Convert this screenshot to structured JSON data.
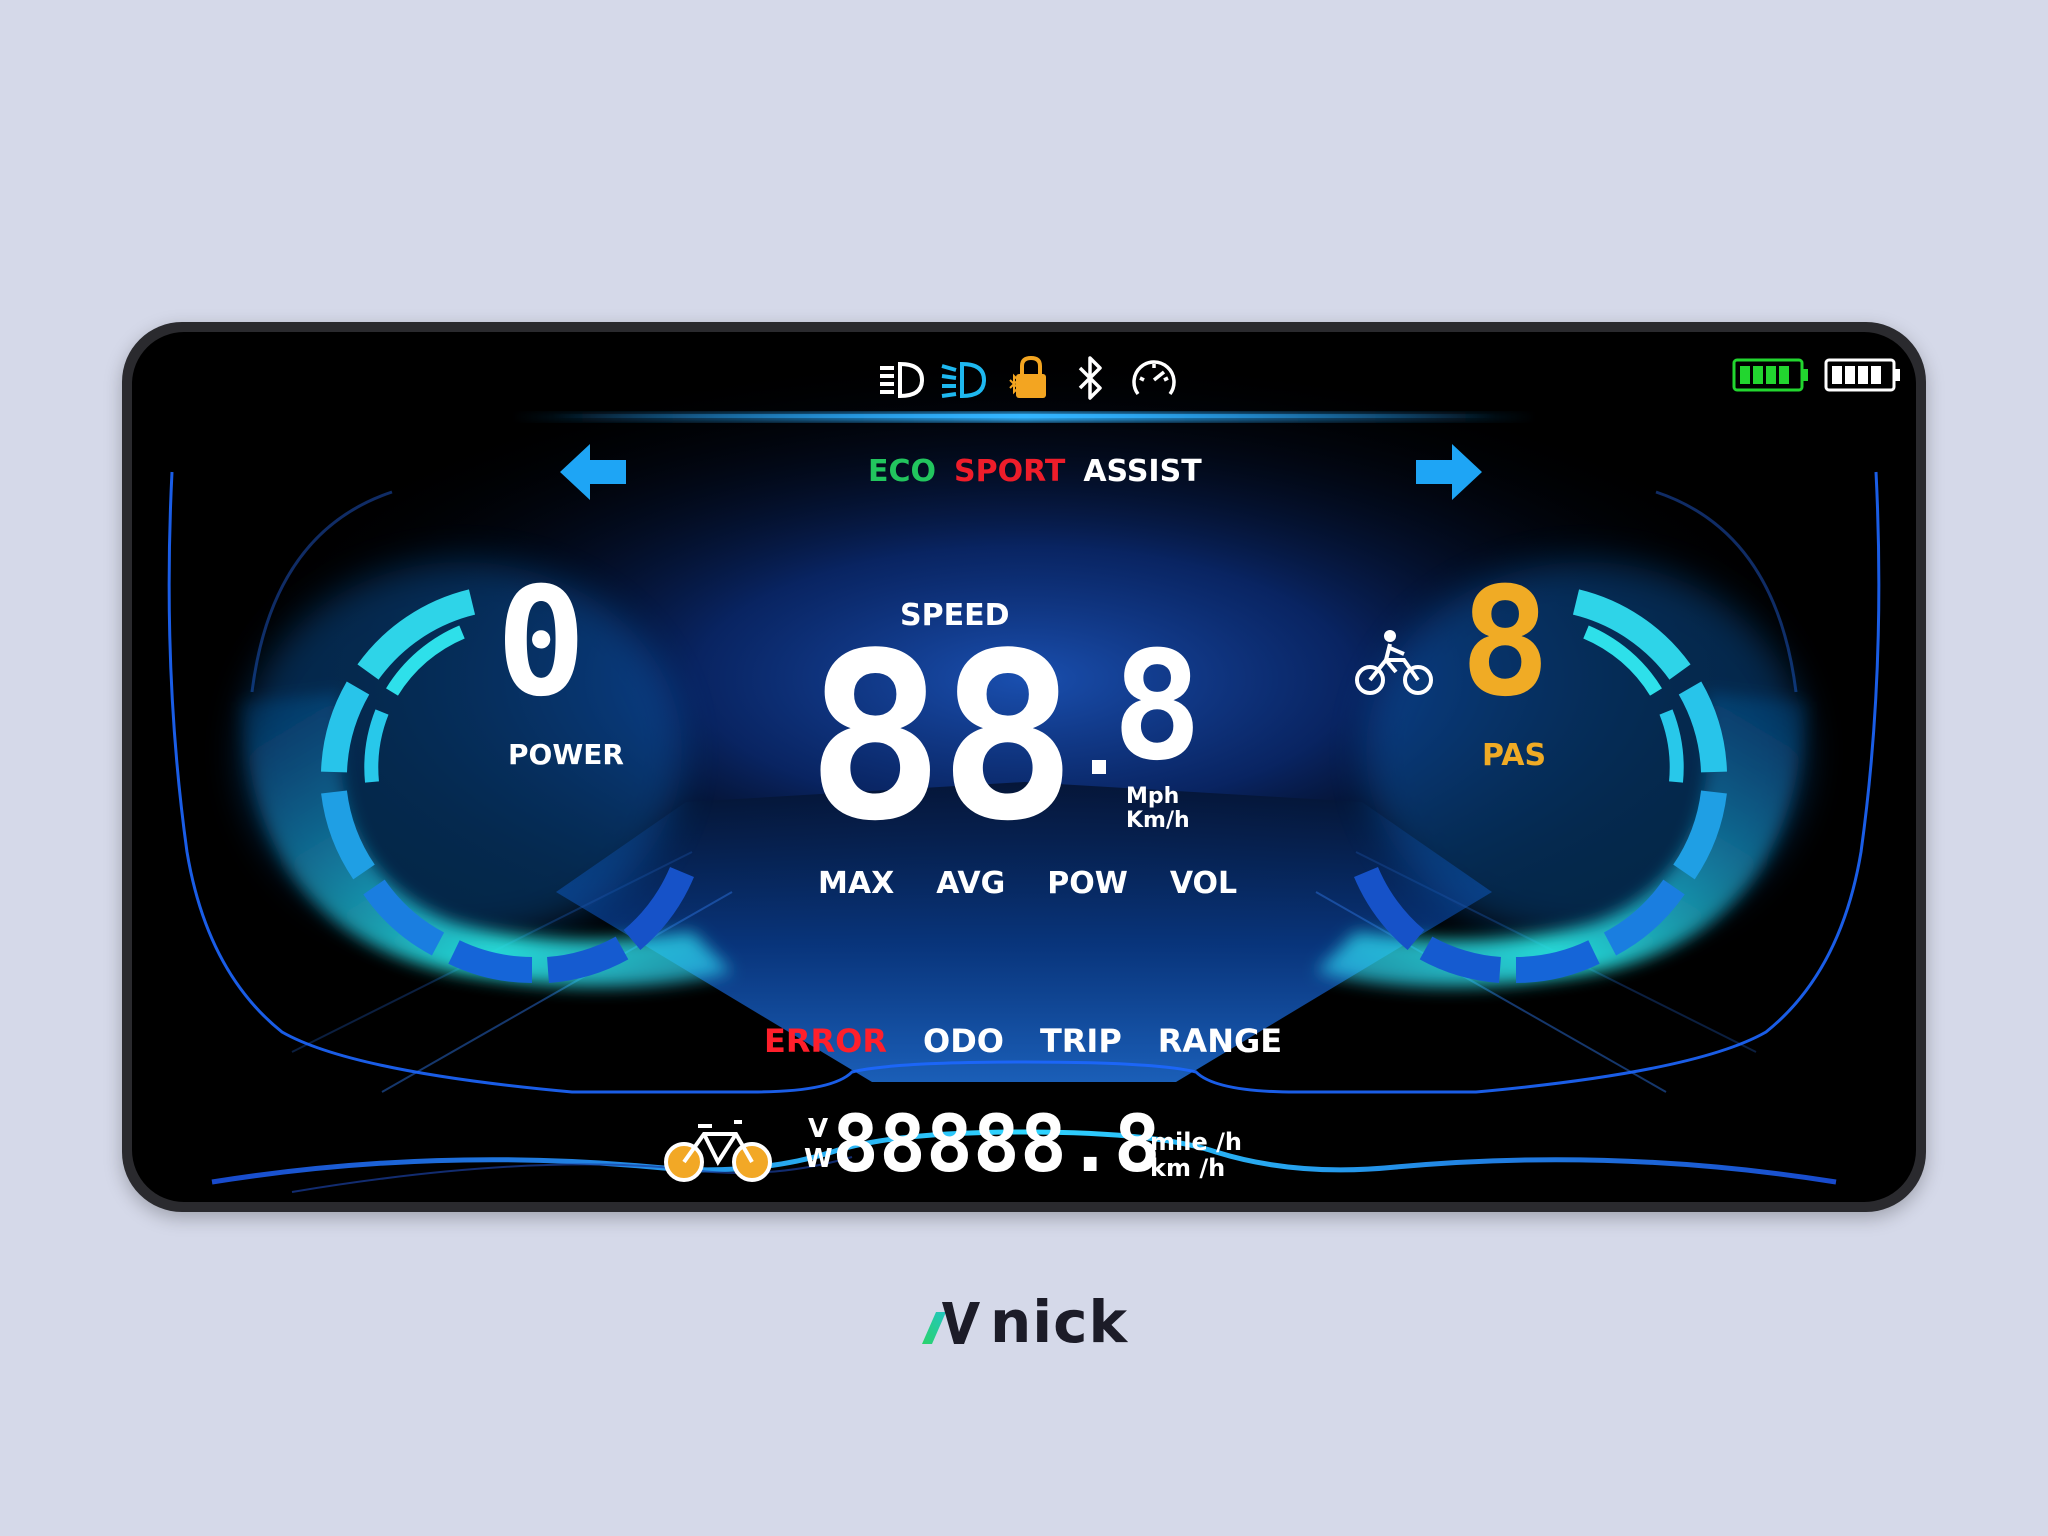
{
  "indicators": {
    "icons": [
      "low-beam-icon",
      "high-beam-icon",
      "lock-bluetooth-icon",
      "bluetooth-icon",
      "speedometer-icon"
    ],
    "battery_levels": [
      1.0,
      1.0
    ],
    "colors": {
      "battery_1": "#22d62f",
      "battery_2": "#ffffff",
      "lock_icon": "#f3a521",
      "high_beam_icon": "#1eb8f0"
    }
  },
  "turn_signals": {
    "left": "left-arrow-icon",
    "right": "right-arrow-icon",
    "color": "#1ea5f5"
  },
  "modes": {
    "eco": "ECO",
    "sport": "SPORT",
    "assist": "ASSIST",
    "colors": {
      "eco": "#22c55e",
      "sport": "#ef1d2a",
      "assist": "#ffffff"
    }
  },
  "power": {
    "value": "0",
    "label": "POWER"
  },
  "pas": {
    "value": "8",
    "label": "PAS",
    "color": "#f0ab25",
    "icon": "cyclist-icon"
  },
  "speed": {
    "label": "SPEED",
    "value": "88",
    "decimal": "8",
    "unit_1": "Mph",
    "unit_2": "Km/h"
  },
  "stats": {
    "max": "MAX",
    "avg": "AVG",
    "pow": "POW",
    "vol": "VOL"
  },
  "info_menu": {
    "error": "ERROR",
    "odo": "ODO",
    "trip": "TRIP",
    "range": "RANGE",
    "colors": {
      "error": "#ff1f2b",
      "normal": "#ffffff"
    }
  },
  "odometer": {
    "icon": "bicycle-icon",
    "unit_v": "V",
    "unit_w": "W",
    "value": "88888.8",
    "unit_1": "mile /h",
    "unit_2": "km /h",
    "icon_color": "#f2a826"
  },
  "brand": {
    "name": "nick",
    "icon": "brand-logo-icon"
  }
}
